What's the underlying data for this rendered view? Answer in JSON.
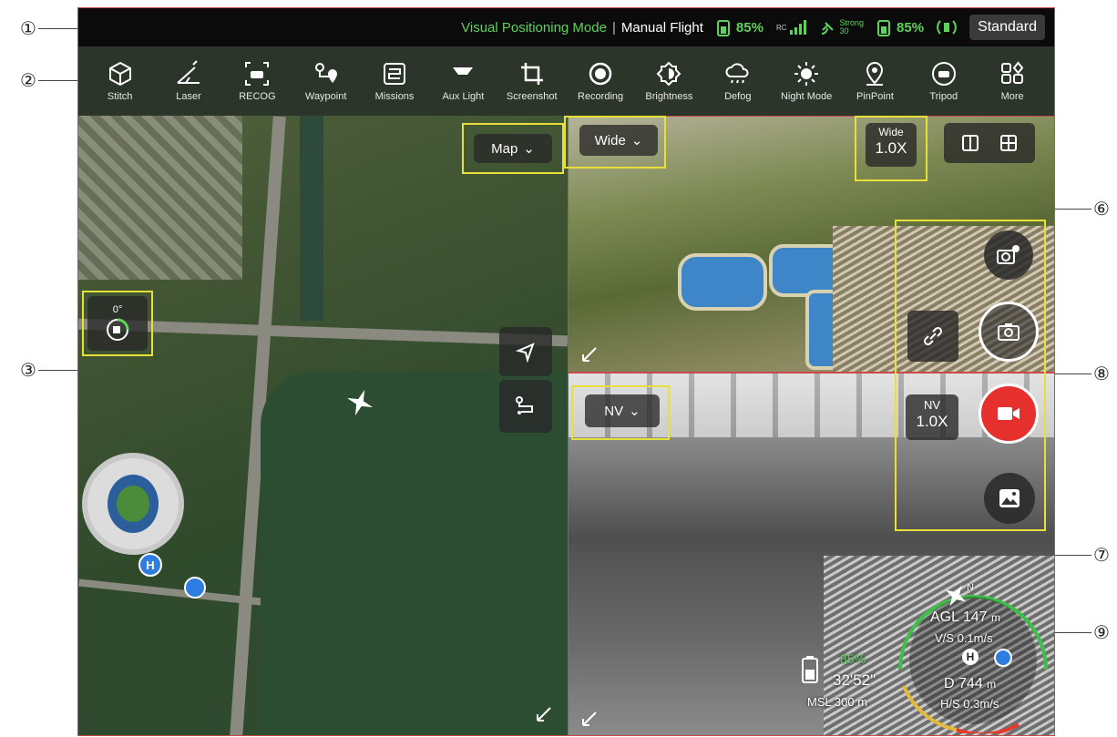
{
  "callouts": [
    "①",
    "②",
    "③",
    "⑥",
    "⑧",
    "⑦",
    "⑨"
  ],
  "status_bar": {
    "mode": "Visual Positioning Mode",
    "separator": "|",
    "flight_mode": "Manual Flight",
    "rc_battery": "85%",
    "signal_label": "RC",
    "gps_strength": "Strong",
    "gps_count": "30",
    "drone_battery": "85%",
    "standard_label": "Standard",
    "accent_color": "#5cd35a"
  },
  "toolbar": {
    "items": [
      {
        "label": "Stitch",
        "icon": "cube-icon"
      },
      {
        "label": "Laser",
        "icon": "laser-icon"
      },
      {
        "label": "RECOG",
        "icon": "car-recog-icon"
      },
      {
        "label": "Waypoint",
        "icon": "waypoint-icon"
      },
      {
        "label": "Missions",
        "icon": "missions-icon"
      },
      {
        "label": "Aux Light",
        "icon": "aux-light-icon"
      },
      {
        "label": "Screenshot",
        "icon": "crop-icon"
      },
      {
        "label": "Recording",
        "icon": "record-icon"
      },
      {
        "label": "Brightness",
        "icon": "brightness-icon"
      },
      {
        "label": "Defog",
        "icon": "defog-icon"
      },
      {
        "label": "Night Mode",
        "icon": "night-mode-icon"
      },
      {
        "label": "PinPoint",
        "icon": "pinpoint-icon"
      },
      {
        "label": "Tripod",
        "icon": "tripod-icon"
      },
      {
        "label": "More",
        "icon": "more-grid-icon"
      }
    ]
  },
  "map_pane": {
    "map_select": "Map",
    "compass_angle": "0°"
  },
  "wide_pane": {
    "lens_select": "Wide",
    "zoom_lens": "Wide",
    "zoom_value": "1.0X"
  },
  "nv_pane": {
    "lens_select": "NV",
    "zoom_lens": "NV",
    "zoom_value": "1.0X"
  },
  "telemetry": {
    "agl_label": "AGL",
    "agl_value": "147",
    "agl_unit": "m",
    "vs_label": "V/S",
    "vs_value": "0.1",
    "vs_unit": "m/s",
    "distance_label": "D",
    "distance_value": "744",
    "distance_unit": "m",
    "hs_label": "H/S",
    "hs_value": "0.3",
    "hs_unit": "m/s",
    "battery": "85%",
    "flight_time": "32'52\"",
    "msl_label": "MSL",
    "msl_value": "300",
    "msl_unit": "m",
    "north": "N",
    "home_marker": "H"
  }
}
